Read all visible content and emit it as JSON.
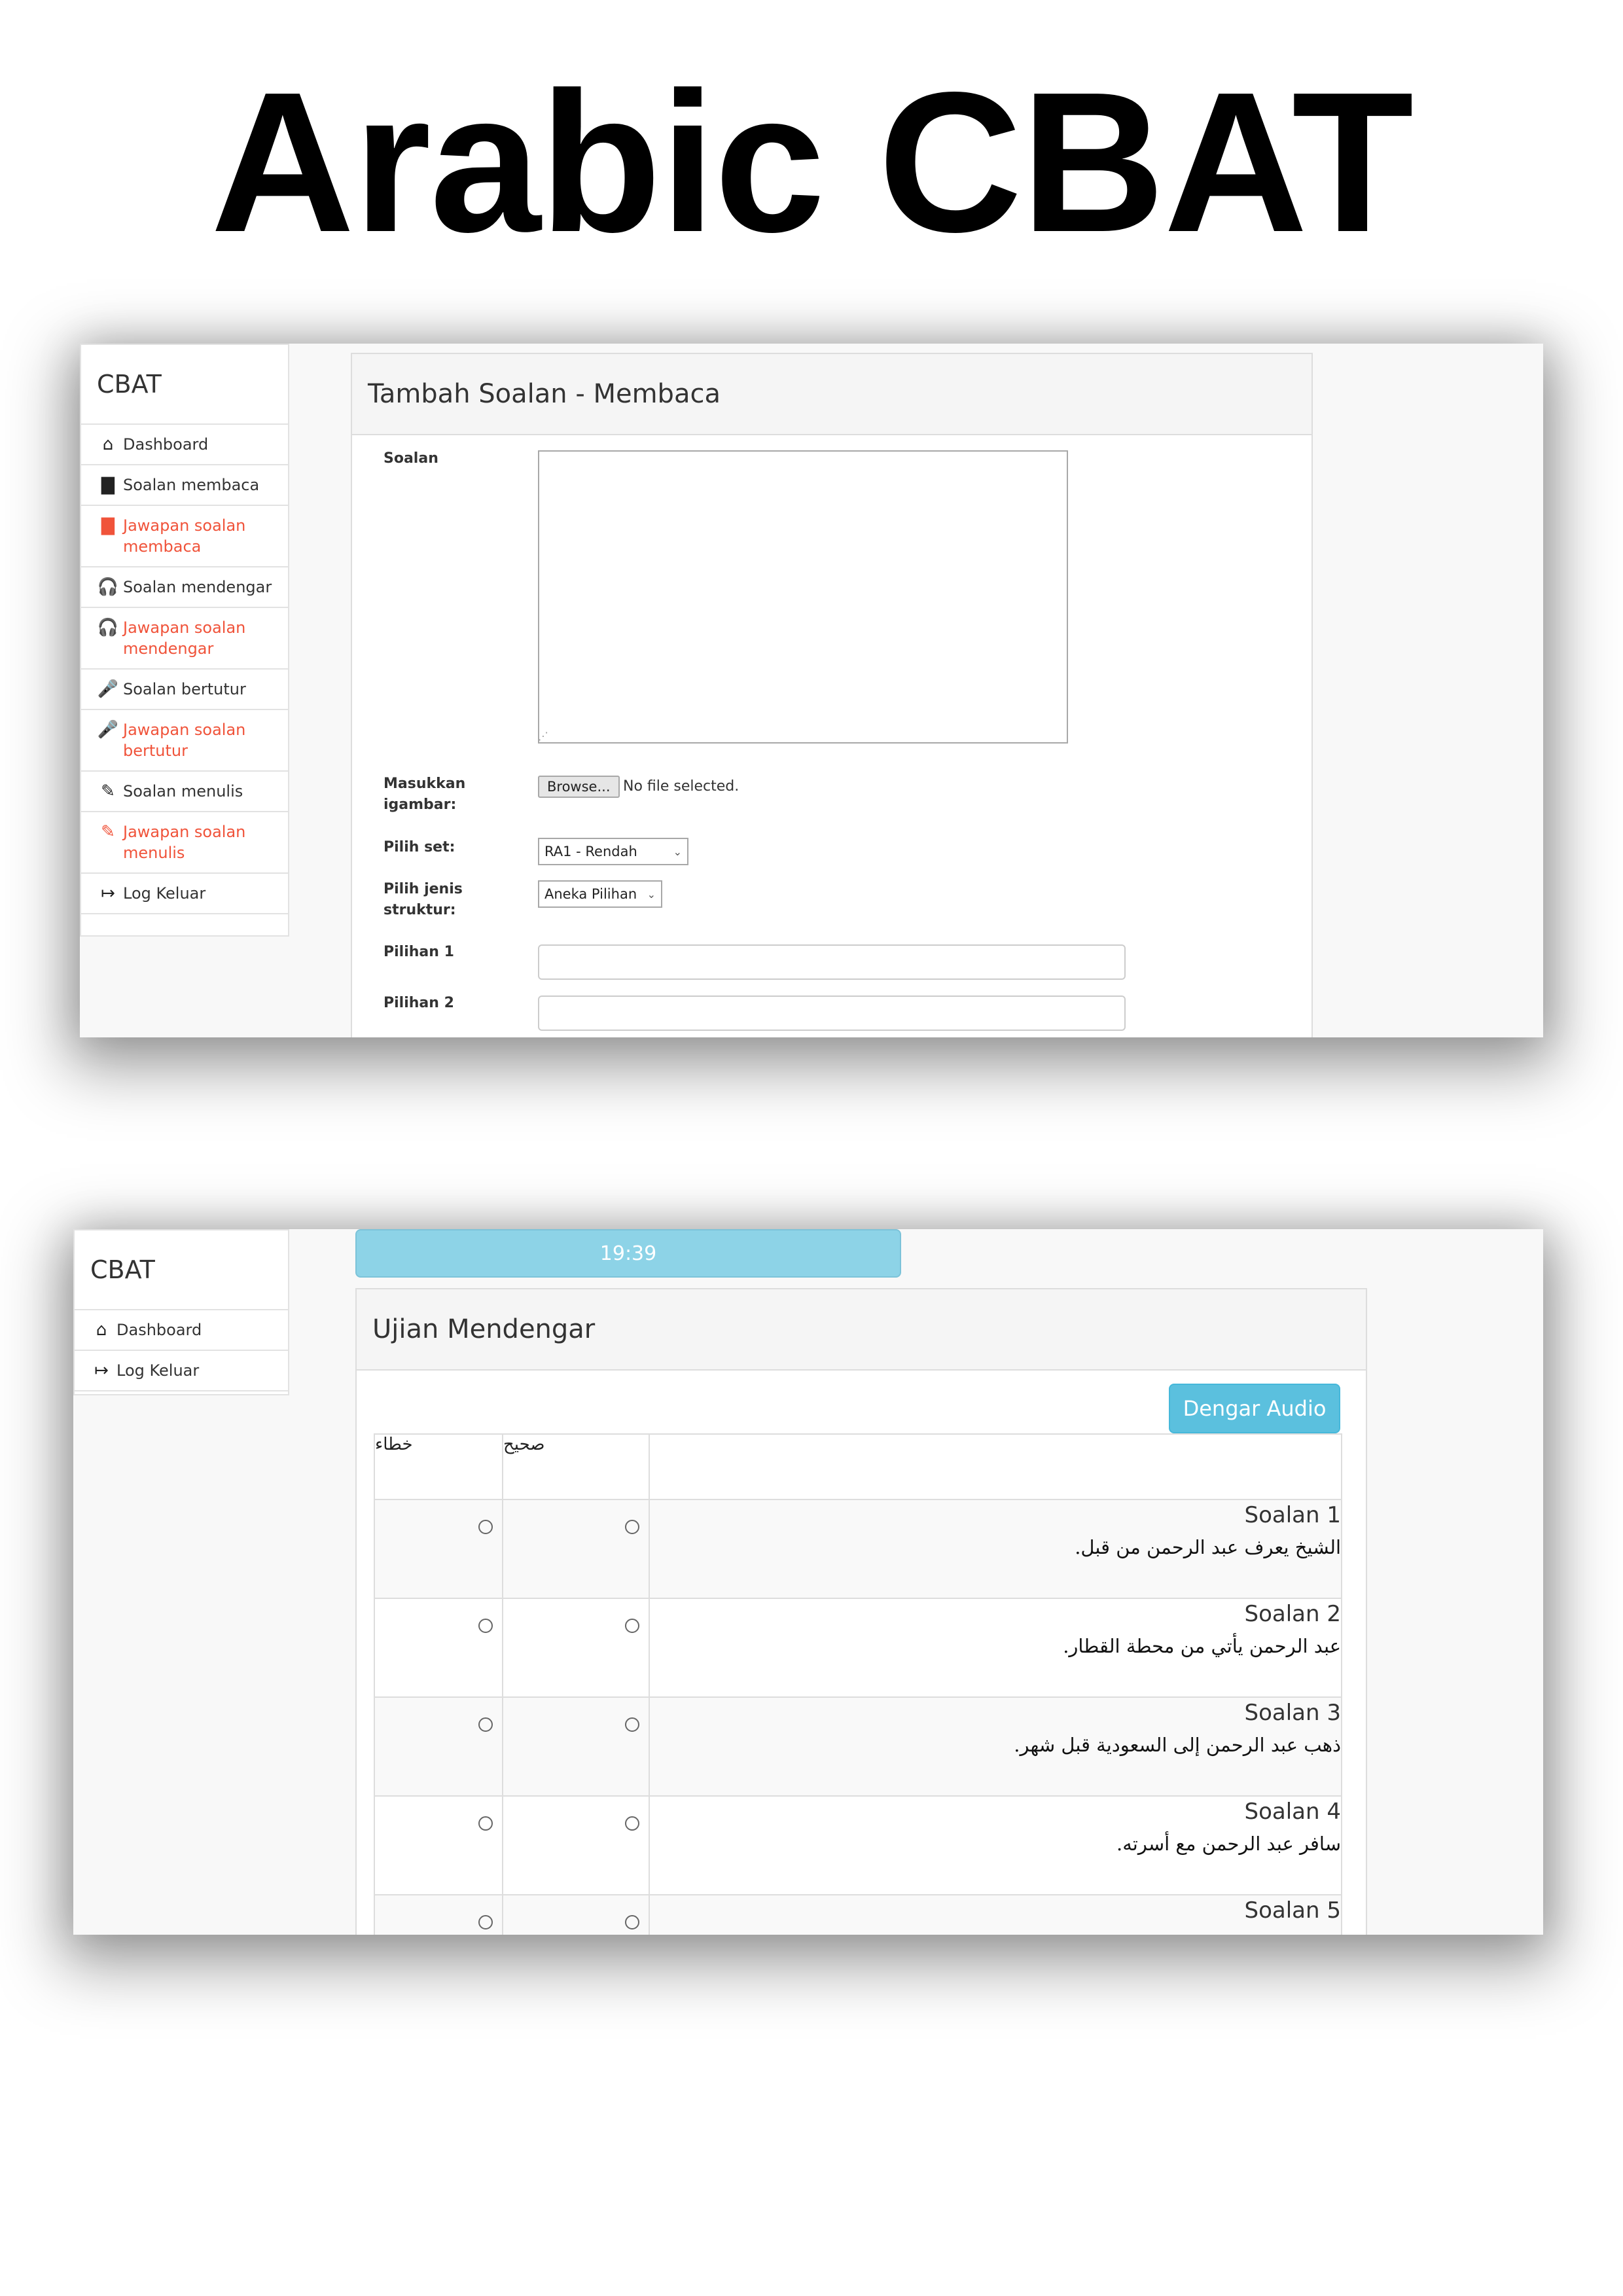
{
  "poster_title": "Arabic CBAT",
  "screen1": {
    "brand": "CBAT",
    "nav": [
      {
        "label": "Dashboard",
        "icon": "home-icon",
        "glyph": "⌂",
        "active": false
      },
      {
        "label": "Soalan membaca",
        "icon": "book-icon",
        "glyph": "▇",
        "active": false
      },
      {
        "label": "Jawapan soalan membaca",
        "icon": "book-icon",
        "glyph": "▇",
        "active": true
      },
      {
        "label": "Soalan mendengar",
        "icon": "headphones-icon",
        "glyph": "🎧",
        "active": false
      },
      {
        "label": "Jawapan soalan mendengar",
        "icon": "headphones-icon",
        "glyph": "🎧",
        "active": true
      },
      {
        "label": "Soalan bertutur",
        "icon": "microphone-icon",
        "glyph": "🎤",
        "active": false
      },
      {
        "label": "Jawapan soalan bertutur",
        "icon": "microphone-icon",
        "glyph": "🎤",
        "active": true
      },
      {
        "label": "Soalan menulis",
        "icon": "pencil-icon",
        "glyph": "✎",
        "active": false
      },
      {
        "label": "Jawapan soalan menulis",
        "icon": "pencil-icon",
        "glyph": "✎",
        "active": true
      },
      {
        "label": "Log Keluar",
        "icon": "sign-out-icon",
        "glyph": "↦",
        "active": false
      }
    ],
    "panel_title": "Tambah Soalan - Membaca",
    "form": {
      "soalan_label": "Soalan",
      "soalan_value": "",
      "image_label": "Masukkan igambar:",
      "browse_label": "Browse...",
      "no_file_text": "No file selected.",
      "set_label": "Pilih set:",
      "set_value": "RA1 - Rendah",
      "struktur_label": "Pilih jenis struktur:",
      "struktur_value": "Aneka Pilihan",
      "pilihan1_label": "Pilihan 1",
      "pilihan1_value": "",
      "pilihan2_label": "Pilihan 2",
      "pilihan2_value": ""
    }
  },
  "screen2": {
    "brand": "CBAT",
    "nav": [
      {
        "label": "Dashboard",
        "icon": "home-icon",
        "glyph": "⌂"
      },
      {
        "label": "Log Keluar",
        "icon": "sign-out-icon",
        "glyph": "↦"
      }
    ],
    "timer": "19:39",
    "panel_title": "Ujian Mendengar",
    "audio_button": "Dengar Audio",
    "headers": {
      "wrong": "خطاء",
      "right": "صحيح",
      "question": ""
    },
    "questions": [
      {
        "title": "Soalan 1",
        "text": "الشيخ يعرف عبد الرحمن من قبل."
      },
      {
        "title": "Soalan 2",
        "text": "عبد الرحمن يأتي من محطة القطار."
      },
      {
        "title": "Soalan 3",
        "text": "ذهب عبد الرحمن إلى السعودية قبل شهر."
      },
      {
        "title": "Soalan 4",
        "text": "سافر عبد الرحمن مع أسرته."
      },
      {
        "title": "Soalan 5",
        "text": ""
      }
    ]
  }
}
